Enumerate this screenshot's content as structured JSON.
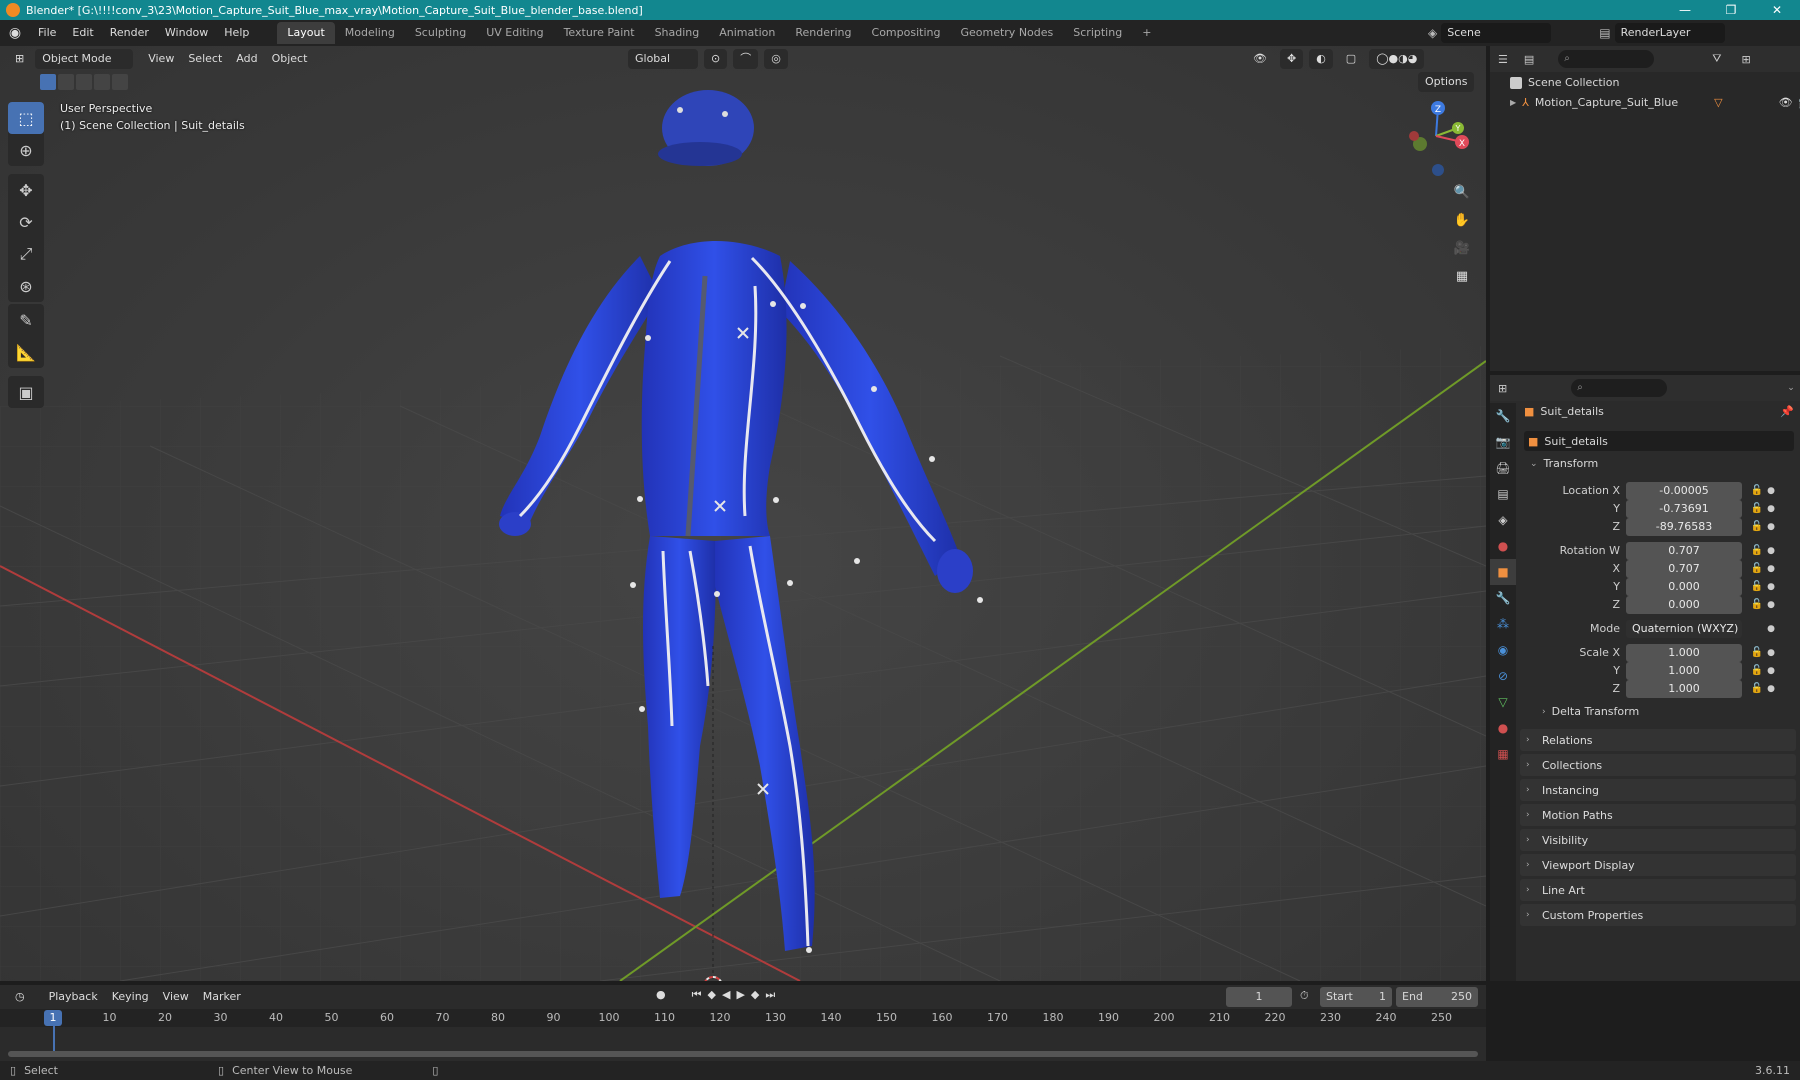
{
  "window": {
    "title": "Blender* [G:\\!!!!conv_3\\23\\Motion_Capture_Suit_Blue_max_vray\\Motion_Capture_Suit_Blue_blender_base.blend]",
    "controls": [
      "—",
      "❐",
      "✕"
    ]
  },
  "menubar": {
    "menus": [
      "File",
      "Edit",
      "Render",
      "Window",
      "Help"
    ],
    "workspaces": [
      "Layout",
      "Modeling",
      "Sculpting",
      "UV Editing",
      "Texture Paint",
      "Shading",
      "Animation",
      "Rendering",
      "Compositing",
      "Geometry Nodes",
      "Scripting"
    ],
    "active_workspace": "Layout",
    "add_tab": "+",
    "scene": "Scene",
    "render_layer": "RenderLayer"
  },
  "viewport": {
    "mode": "Object Mode",
    "menus": [
      "View",
      "Select",
      "Add",
      "Object"
    ],
    "orientation": "Global",
    "options_label": "Options",
    "overlay_line1": "User Perspective",
    "overlay_line2": "(1) Scene Collection | Suit_details",
    "gizmo": {
      "z": "Z",
      "y": "Y",
      "x": "X"
    }
  },
  "outliner": {
    "root": "Scene Collection",
    "items": [
      {
        "label": "Motion_Capture_Suit_Blue"
      }
    ]
  },
  "properties": {
    "object_name": "Suit_details",
    "datablock_name": "Suit_details",
    "transform_label": "Transform",
    "location": {
      "label": "Location X",
      "x": "-0.00005",
      "y": "-0.73691",
      "z": "-89.76583"
    },
    "rotation": {
      "label": "Rotation W",
      "w": "0.707",
      "x": "0.707",
      "y": "0.000",
      "z": "0.000"
    },
    "axis_labels": {
      "x": "X",
      "y": "Y",
      "z": "Z"
    },
    "mode": {
      "label": "Mode",
      "value": "Quaternion (WXYZ)"
    },
    "scale": {
      "label": "Scale X",
      "x": "1.000",
      "y": "1.000",
      "z": "1.000"
    },
    "delta_transform": "Delta Transform",
    "panels": [
      "Relations",
      "Collections",
      "Instancing",
      "Motion Paths",
      "Visibility",
      "Viewport Display",
      "Line Art",
      "Custom Properties"
    ]
  },
  "timeline": {
    "menus": [
      "Playback",
      "Keying",
      "View",
      "Marker"
    ],
    "current_frame": "1",
    "start_label": "Start",
    "start": "1",
    "end_label": "End",
    "end": "250",
    "ticks": [
      "10",
      "20",
      "30",
      "40",
      "50",
      "60",
      "70",
      "80",
      "90",
      "100",
      "110",
      "120",
      "130",
      "140",
      "150",
      "160",
      "170",
      "180",
      "190",
      "200",
      "210",
      "220",
      "230",
      "240",
      "250"
    ],
    "playhead": "1"
  },
  "statusbar": {
    "select": "Select",
    "center_view": "Center View to Mouse",
    "version": "3.6.11"
  },
  "colors": {
    "accent": "#4772b3",
    "suit": "#2e47d6",
    "titlebar": "#12878f"
  }
}
